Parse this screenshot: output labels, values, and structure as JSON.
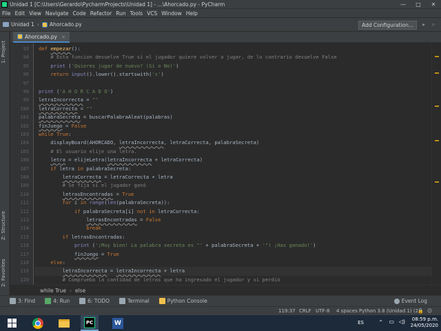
{
  "window": {
    "title": "Unidad 1 [C:\\Users\\Gerardo\\PycharmProjects\\Unidad 1] - ...\\Ahorcado.py - PyCharm",
    "controls": [
      "—",
      "□",
      "✕"
    ]
  },
  "menu": [
    "File",
    "Edit",
    "View",
    "Navigate",
    "Code",
    "Refactor",
    "Run",
    "Tools",
    "VCS",
    "Window",
    "Help"
  ],
  "navbar": {
    "project": "Unidad 1",
    "file": "Ahorcado.py",
    "config_button": "Add Configuration..."
  },
  "side_tabs": {
    "project": "1: Project",
    "structure": "Z: Structure",
    "favorites": "2: Favorites"
  },
  "editor": {
    "tab_label": "Ahorcado.py",
    "tab_close": "×",
    "current_line": 119,
    "lines": [
      {
        "n": 93,
        "html": "<span class=\"kw\">def</span> <span class=\"fn sq\">empezar</span>():"
      },
      {
        "n": 94,
        "html": "    <span class=\"cm\"># Esta funcion devuelve True si el jugador quiere volver a jugar, de lo contrario devuelve False</span>"
      },
      {
        "n": 95,
        "html": "    <span class=\"bi\">print</span> (<span class=\"st\">'Quieres jugar de nuevo? (Si o No)'</span>)"
      },
      {
        "n": 96,
        "html": "    <span class=\"kw\">return</span> <span class=\"bi\">input</span>().lower().startswith(<span class=\"st\">'s'</span>)"
      },
      {
        "n": 97,
        "html": ""
      },
      {
        "n": 98,
        "html": "<span class=\"bi\">print</span> (<span class=\"st\">'A H O R C A D O'</span>)"
      },
      {
        "n": 99,
        "html": "<span class=\"sq\">letraIncorrecta</span> = <span class=\"st\">\"\"</span>"
      },
      {
        "n": 100,
        "html": "<span class=\"sq\">letraCorrecta</span> = <span class=\"st\">\"\"</span>"
      },
      {
        "n": 101,
        "html": "<span class=\"sq\">palabraSecreta</span> = buscarPalabraAleat(palabras)"
      },
      {
        "n": 102,
        "html": "<span class=\"sq\">finJuego</span> = <span class=\"kw\">False</span>"
      },
      {
        "n": 103,
        "html": "<span class=\"kw\">while</span> <span class=\"kw\">True</span>:"
      },
      {
        "n": 104,
        "html": "    displayBoard(AHORCADO, <span class=\"sq\">letraIncorrecta</span>, letraCorrecta, palabraSecreta)"
      },
      {
        "n": 105,
        "html": "    <span class=\"cm\"># El usuario elije una letra.</span>"
      },
      {
        "n": 106,
        "html": "    <span class=\"sq\">letra</span> = elijeLetra(<span class=\"sq\">letraIncorrecta</span> + letraCorrecta)"
      },
      {
        "n": 107,
        "html": "    <span class=\"kw\">if</span> letra <span class=\"kw\">in</span> palabraSecreta:"
      },
      {
        "n": 108,
        "html": "        <span class=\"sq\">letraCorrecta</span> = letraCorrecta + letra"
      },
      {
        "n": 109,
        "html": "        <span class=\"cm\"># Se fija si el jugador ganó</span>"
      },
      {
        "n": 110,
        "html": "        <span class=\"sq\">letrasEncontradas</span> = <span class=\"kw\">True</span>"
      },
      {
        "n": 111,
        "html": "        <span class=\"kw\">for</span> i <span class=\"kw\">in</span> <span class=\"bi\">range</span>(<span class=\"bi\">len</span>(palabraSecreta)):"
      },
      {
        "n": 112,
        "html": "            <span class=\"kw\">if</span> palabraSecreta[i] <span class=\"kw\">not in</span> letraCorrecta:"
      },
      {
        "n": 113,
        "html": "                <span class=\"sq\">letrasEncontradas</span> = <span class=\"kw\">False</span>"
      },
      {
        "n": 114,
        "html": "                <span class=\"kw\">break</span>"
      },
      {
        "n": 115,
        "html": "        <span class=\"kw\">if</span> letrasEncontradas:"
      },
      {
        "n": 116,
        "html": "            <span class=\"bi\">print</span> (<span class=\"st\">'¡Muy bien! La palabra secreta es \"'</span> + palabraSecreta + <span class=\"st\">'\"! ¡Has ganado!'</span>)"
      },
      {
        "n": 117,
        "html": "            <span class=\"sq\">finJuego</span> = <span class=\"kw\">True</span>"
      },
      {
        "n": 118,
        "html": "    <span class=\"kw\">else</span>:"
      },
      {
        "n": 119,
        "html": "        <span class=\"sq\">letraIncorrecta</span> = <span class=\"sq\">letraIncorrecta</span> + letra"
      },
      {
        "n": 120,
        "html": "        <span class=\"cm\"># Comprueba la cantidad de letras que ha ingresado el jugador y si perdió</span>"
      }
    ]
  },
  "breadcrumb": [
    "while True",
    "else"
  ],
  "toolwindows": [
    {
      "label": "3: Find",
      "icon": "find-icon",
      "color": "#9aa7b0"
    },
    {
      "label": "4: Run",
      "icon": "run-icon",
      "color": "#59a869"
    },
    {
      "label": "6: TODO",
      "icon": "todo-icon",
      "color": "#9aa7b0"
    },
    {
      "label": "Terminal",
      "icon": "terminal-icon",
      "color": "#9aa7b0"
    },
    {
      "label": "Python Console",
      "icon": "python-console-icon",
      "color": "#f0c14b"
    }
  ],
  "event_log": "Event Log",
  "status": {
    "position": "119:37",
    "line_sep": "CRLF",
    "encoding": "UTF-8",
    "indent": "4 spaces",
    "interpreter": "Python 3.8 (Unidad 1) (2)"
  },
  "taskbar": {
    "lang": "ES",
    "time": "08:59 p.m.",
    "date": "24/05/2020"
  }
}
